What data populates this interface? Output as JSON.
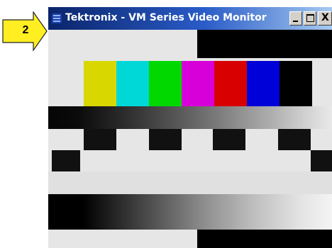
{
  "callout": {
    "label": "2"
  },
  "window": {
    "title": "Tektronix - VM Series Video Monitor",
    "close_glyph": "X"
  },
  "icons": {
    "app": "tektronix-app-icon",
    "minimize": "minimize-icon",
    "maximize": "maximize-icon",
    "close": "close-icon"
  },
  "colors": {
    "title_bar_start": "#0a246a",
    "title_bar_end": "#a6caf0",
    "callout_fill": "#ffee22",
    "color_bars": [
      "#d8d800",
      "#00d8d8",
      "#00d800",
      "#d800d8",
      "#d80000",
      "#0000d8"
    ]
  }
}
